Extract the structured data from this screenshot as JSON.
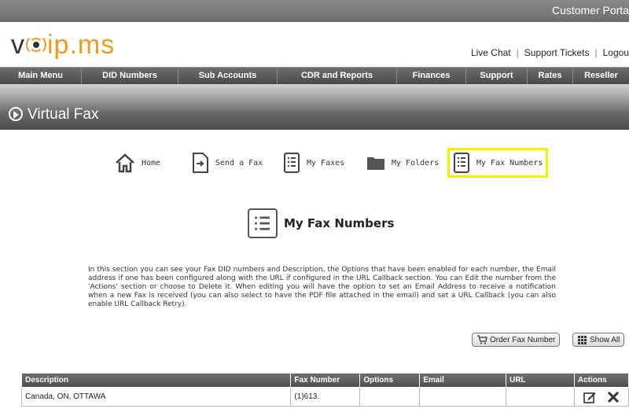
{
  "topbar": {
    "portal_label": "Customer Porta"
  },
  "logo": {
    "left": "v",
    "right": "ip.ms"
  },
  "toplinks": [
    "Live Chat",
    "Support Tickets",
    "Logou"
  ],
  "mainnav": [
    "Main Menu",
    "DID Numbers",
    "Sub Accounts",
    "CDR and Reports",
    "Finances",
    "Support",
    "Rates",
    "Reseller"
  ],
  "banner": {
    "title": "Virtual Fax"
  },
  "subnav": {
    "home": "Home",
    "send": "Send a Fax",
    "faxes": "My Faxes",
    "folders": "My Folders",
    "numbers": "My Fax Numbers"
  },
  "section": {
    "title": "My Fax Numbers"
  },
  "description": "In this section you can see your Fax DID numbers and Description, the Options that have been enabled for each number, the Email address if one has been configured along with the URL if configured in the URL Callback section. You can Edit the number from the 'Actions' section or choose to Delete it. When editing you will have the option to set an Email Address to receive a notification when a new Fax is received (you can also select to have the PDF file attached in the email) and set a URL Callback (you can also enable URL Callback Retry).",
  "buttons": {
    "order": "Order Fax Number",
    "show_all": "Show All"
  },
  "table": {
    "headers": [
      "Description",
      "Fax Number",
      "Options",
      "Email",
      "URL",
      "Actions"
    ],
    "rows": [
      {
        "description": "Canada, ON, OTTAWA",
        "fax_number": "(1)613.",
        "options": "",
        "email": "",
        "url": ""
      }
    ]
  }
}
